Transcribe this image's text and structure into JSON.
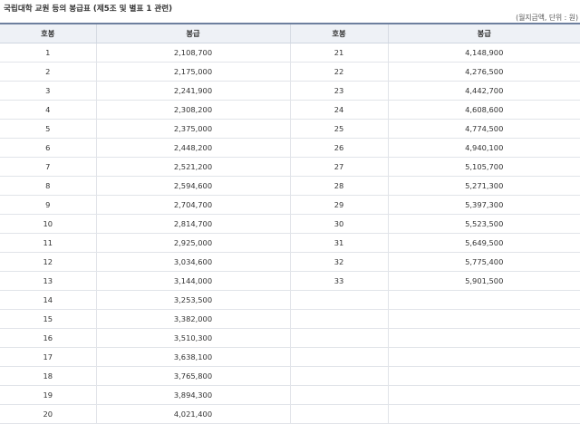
{
  "title": "국립대학 교원 등의 봉급표 (제5조 및 별표 1 관련)",
  "unit_note": "(월지급액, 단위 : 원)",
  "columns": {
    "grade": "호봉",
    "salary": "봉급"
  },
  "rows": [
    {
      "left_grade": "1",
      "left_salary": "2,108,700",
      "right_grade": "21",
      "right_salary": "4,148,900"
    },
    {
      "left_grade": "2",
      "left_salary": "2,175,000",
      "right_grade": "22",
      "right_salary": "4,276,500"
    },
    {
      "left_grade": "3",
      "left_salary": "2,241,900",
      "right_grade": "23",
      "right_salary": "4,442,700"
    },
    {
      "left_grade": "4",
      "left_salary": "2,308,200",
      "right_grade": "24",
      "right_salary": "4,608,600"
    },
    {
      "left_grade": "5",
      "left_salary": "2,375,000",
      "right_grade": "25",
      "right_salary": "4,774,500"
    },
    {
      "left_grade": "6",
      "left_salary": "2,448,200",
      "right_grade": "26",
      "right_salary": "4,940,100"
    },
    {
      "left_grade": "7",
      "left_salary": "2,521,200",
      "right_grade": "27",
      "right_salary": "5,105,700"
    },
    {
      "left_grade": "8",
      "left_salary": "2,594,600",
      "right_grade": "28",
      "right_salary": "5,271,300"
    },
    {
      "left_grade": "9",
      "left_salary": "2,704,700",
      "right_grade": "29",
      "right_salary": "5,397,300"
    },
    {
      "left_grade": "10",
      "left_salary": "2,814,700",
      "right_grade": "30",
      "right_salary": "5,523,500"
    },
    {
      "left_grade": "11",
      "left_salary": "2,925,000",
      "right_grade": "31",
      "right_salary": "5,649,500"
    },
    {
      "left_grade": "12",
      "left_salary": "3,034,600",
      "right_grade": "32",
      "right_salary": "5,775,400"
    },
    {
      "left_grade": "13",
      "left_salary": "3,144,000",
      "right_grade": "33",
      "right_salary": "5,901,500"
    },
    {
      "left_grade": "14",
      "left_salary": "3,253,500",
      "right_grade": "",
      "right_salary": ""
    },
    {
      "left_grade": "15",
      "left_salary": "3,382,000",
      "right_grade": "",
      "right_salary": ""
    },
    {
      "left_grade": "16",
      "left_salary": "3,510,300",
      "right_grade": "",
      "right_salary": ""
    },
    {
      "left_grade": "17",
      "left_salary": "3,638,100",
      "right_grade": "",
      "right_salary": ""
    },
    {
      "left_grade": "18",
      "left_salary": "3,765,800",
      "right_grade": "",
      "right_salary": ""
    },
    {
      "left_grade": "19",
      "left_salary": "3,894,300",
      "right_grade": "",
      "right_salary": ""
    },
    {
      "left_grade": "20",
      "left_salary": "4,021,400",
      "right_grade": "",
      "right_salary": ""
    }
  ]
}
